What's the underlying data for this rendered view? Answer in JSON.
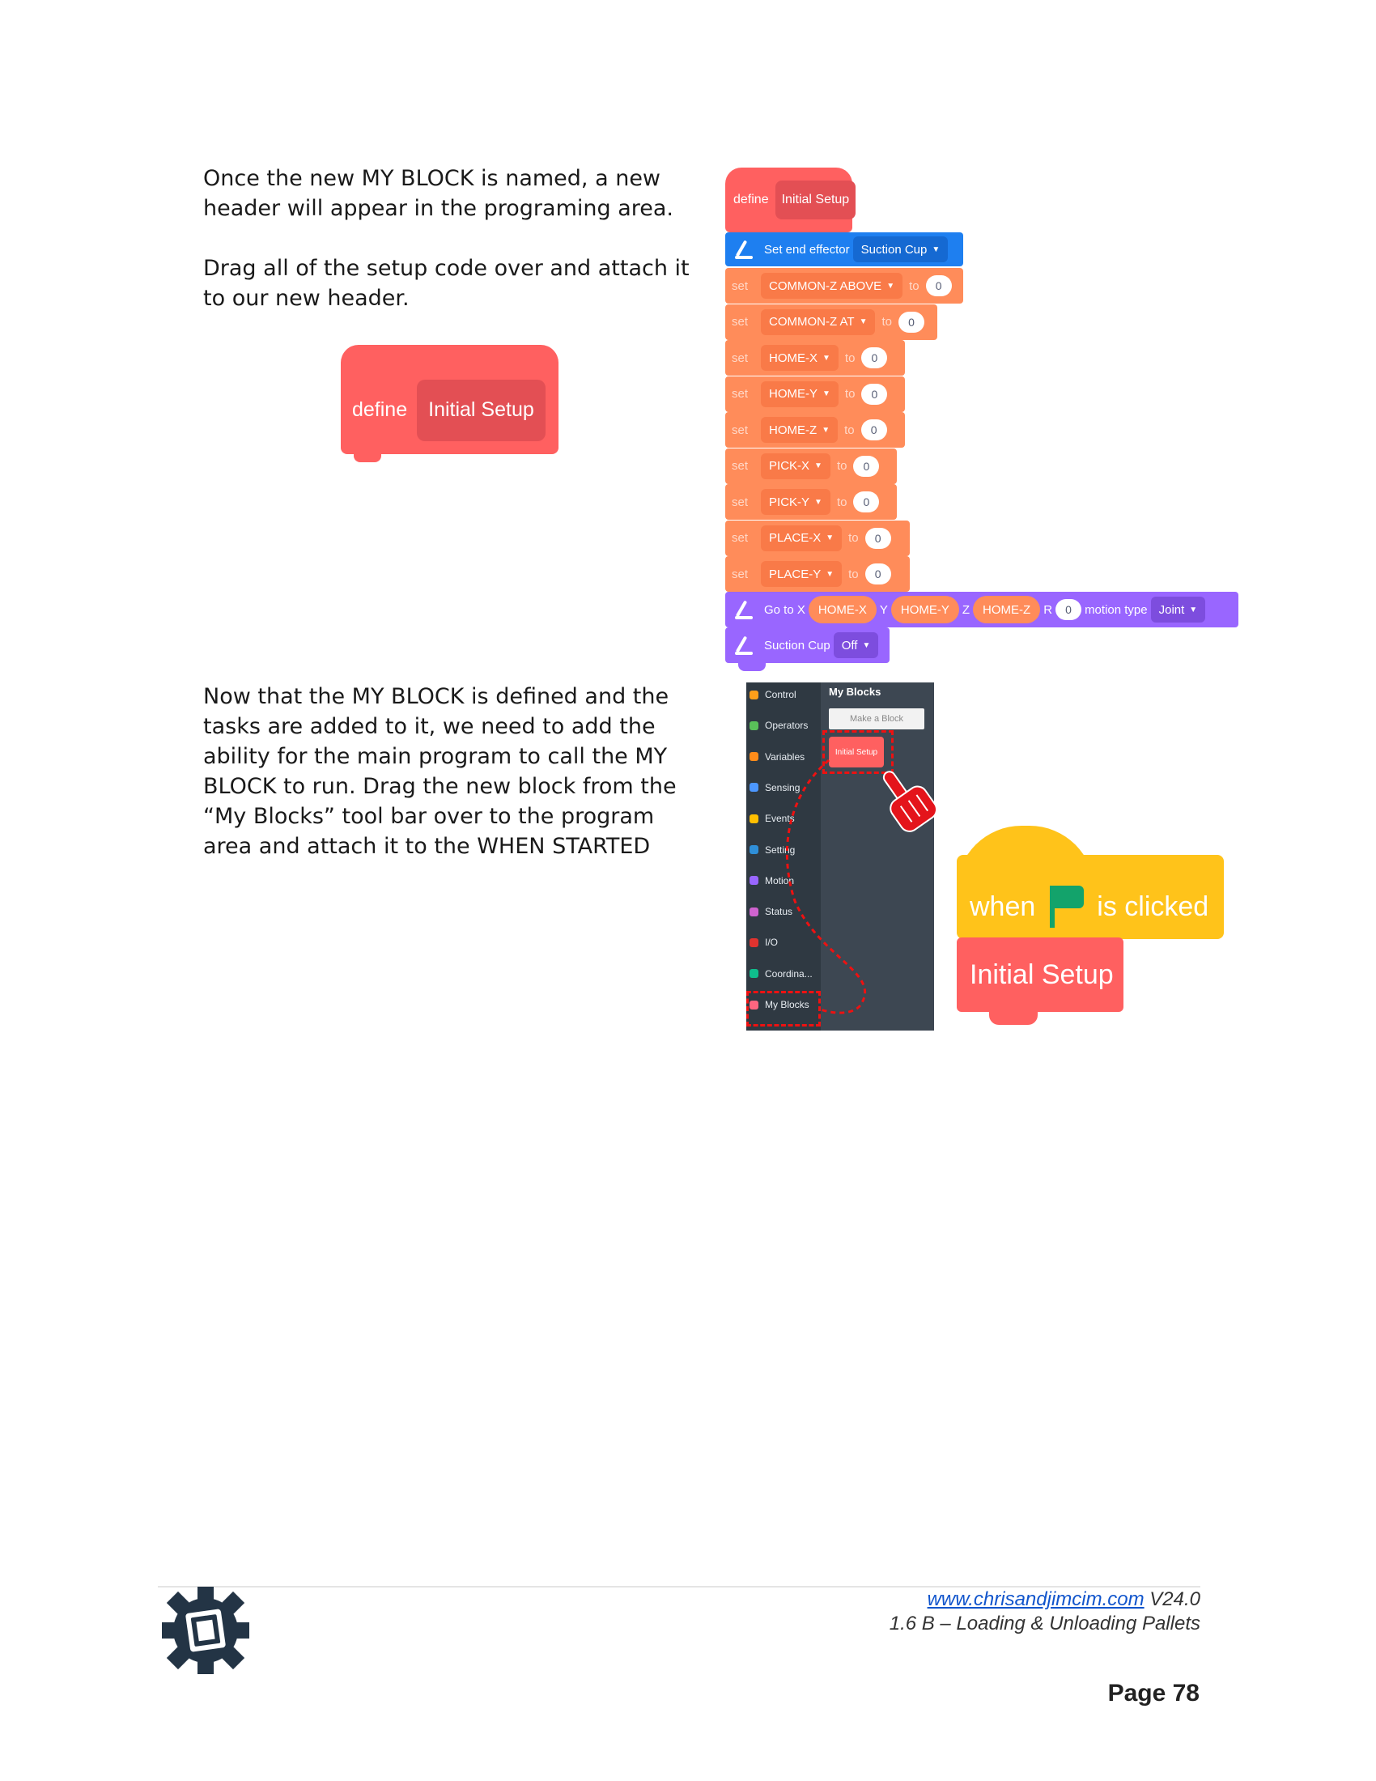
{
  "text": {
    "para1_line1": "Once the new MY BLOCK is named, a new header will appear in the programing area.",
    "para1_line2": "Drag all of the setup code over and attach it to our new header.",
    "para2": "Now that the MY BLOCK is defined and the tasks are added to it, we need to add the ability for the main program to call the MY BLOCK to run. Drag the new block from the “My Blocks” tool bar over to the program area and attach it to the WHEN STARTED"
  },
  "define_block": {
    "keyword": "define",
    "name": "Initial Setup"
  },
  "code_stack": {
    "end_effector": {
      "label": "Set end effector",
      "value": "Suction Cup"
    },
    "set_keyword": "set",
    "to_keyword": "to",
    "set_rows": [
      {
        "var": "COMMON-Z ABOVE",
        "value": "0"
      },
      {
        "var": "COMMON-Z AT",
        "value": "0"
      },
      {
        "var": "HOME-X",
        "value": "0"
      },
      {
        "var": "HOME-Y",
        "value": "0"
      },
      {
        "var": "HOME-Z",
        "value": "0"
      },
      {
        "var": "PICK-X",
        "value": "0"
      },
      {
        "var": "PICK-Y",
        "value": "0"
      },
      {
        "var": "PLACE-X",
        "value": "0"
      },
      {
        "var": "PLACE-Y",
        "value": "0"
      }
    ],
    "goto": {
      "label": "Go to X",
      "x": "HOME-X",
      "y_label": "Y",
      "y": "HOME-Y",
      "z_label": "Z",
      "z": "HOME-Z",
      "r_label": "R",
      "r": "0",
      "motion_label": "motion type",
      "motion": "Joint"
    },
    "suction": {
      "label": "Suction Cup",
      "value": "Off"
    }
  },
  "palette": {
    "title": "My Blocks",
    "make_block": "Make a Block",
    "setup_block": "Initial Setup",
    "categories": [
      {
        "label": "Control",
        "color": "#ff9f1a"
      },
      {
        "label": "Operators",
        "color": "#59c059"
      },
      {
        "label": "Variables",
        "color": "#ff8c1a"
      },
      {
        "label": "Sensing",
        "color": "#4c97ff"
      },
      {
        "label": "Events",
        "color": "#ffbf00"
      },
      {
        "label": "Setting",
        "color": "#2f8fd8"
      },
      {
        "label": "Motion",
        "color": "#9966ff"
      },
      {
        "label": "Status",
        "color": "#cf63cf"
      },
      {
        "label": "I/O",
        "color": "#e0332f"
      },
      {
        "label": "Coordina...",
        "color": "#0fbd8c"
      },
      {
        "label": "My Blocks",
        "color": "#ff6680"
      }
    ]
  },
  "event_block": {
    "when": "when",
    "clicked": "is clicked",
    "call": "Initial Setup"
  },
  "footer": {
    "url": "www.chrisandjimcim.com",
    "version": "V24.0",
    "course": "1.6 B – Loading & Unloading Pallets",
    "page": "Page 78"
  },
  "colors": {
    "define": "#ff6060",
    "variables": "#ff8c5a",
    "motion": "#9966ff",
    "setting": "#1e7ff0",
    "event": "#ffc31a",
    "palette_bg": "#3d4752",
    "link": "#1155cc",
    "highlight": "#e11111"
  }
}
